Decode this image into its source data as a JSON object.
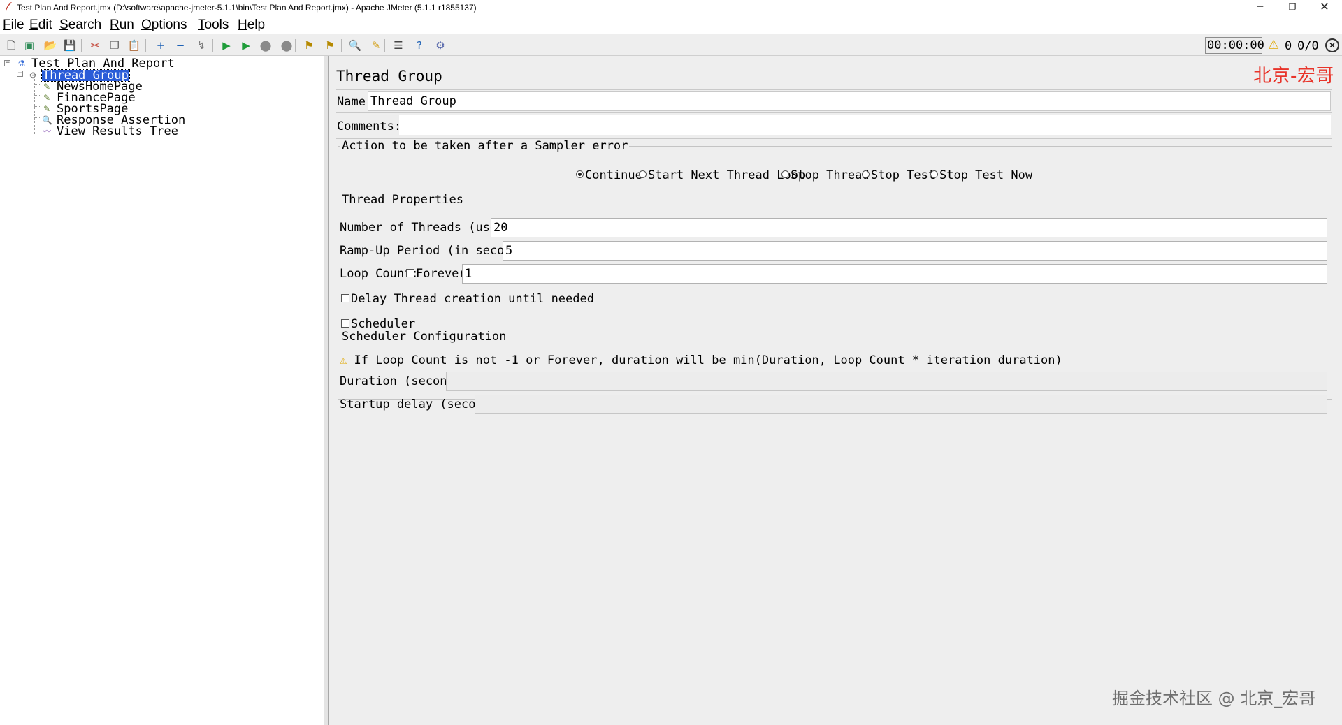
{
  "window": {
    "title": "Test Plan And Report.jmx (D:\\software\\apache-jmeter-5.1.1\\bin\\Test Plan And Report.jmx) - Apache JMeter (5.1.1 r1855137)",
    "minimize_glyph": "─",
    "maximize_glyph": "❐",
    "close_glyph": "✕"
  },
  "menu": {
    "items": [
      "File",
      "Edit",
      "Search",
      "Run",
      "Options",
      "Tools",
      "Help"
    ]
  },
  "toolbar": {
    "buttons": [
      {
        "name": "new-icon",
        "glyph": "🗋",
        "color": "#555555"
      },
      {
        "name": "templates-icon",
        "glyph": "▣",
        "color": "#2e8b57"
      },
      {
        "name": "open-icon",
        "glyph": "📂",
        "color": "#c8a032"
      },
      {
        "name": "save-icon",
        "glyph": "💾",
        "color": "#333333"
      },
      {
        "name": "cut-icon",
        "glyph": "✂",
        "color": "#c0392b"
      },
      {
        "name": "copy-icon",
        "glyph": "❐",
        "color": "#666666"
      },
      {
        "name": "paste-icon",
        "glyph": "📋",
        "color": "#8a6d3b"
      },
      {
        "name": "expand-icon",
        "glyph": "+",
        "color": "#1a5fb4"
      },
      {
        "name": "collapse-icon",
        "glyph": "−",
        "color": "#1a5fb4"
      },
      {
        "name": "toggle-icon",
        "glyph": "↯",
        "color": "#777777"
      },
      {
        "name": "start-icon",
        "glyph": "▶",
        "color": "#1f9d3a"
      },
      {
        "name": "start-no-pauses-icon",
        "glyph": "▶",
        "color": "#1f9d3a"
      },
      {
        "name": "stop-icon",
        "glyph": "⬤",
        "color": "#8a8a8a"
      },
      {
        "name": "shutdown-icon",
        "glyph": "⬤",
        "color": "#8a8a8a"
      },
      {
        "name": "clear-icon",
        "glyph": "⚑",
        "color": "#b58900"
      },
      {
        "name": "clear-all-icon",
        "glyph": "⚑",
        "color": "#b58900"
      },
      {
        "name": "search-icon",
        "glyph": "🔍",
        "color": "#333333"
      },
      {
        "name": "reset-search-icon",
        "glyph": "✎",
        "color": "#d4a017"
      },
      {
        "name": "function-helper-icon",
        "glyph": "☰",
        "color": "#444444"
      },
      {
        "name": "help-icon",
        "glyph": "?",
        "color": "#1a5fb4"
      },
      {
        "name": "remote-icon",
        "glyph": "⚙",
        "color": "#5566aa"
      }
    ],
    "elapsed_time": "00:00:00",
    "warning_glyph": "⚠",
    "error_count": "0",
    "thread_count": "0/0",
    "status_glyph": "✕"
  },
  "tree": {
    "nodes": [
      {
        "label": "Test Plan And Report",
        "icon": "test-plan-icon",
        "glyph": "⚗"
      },
      {
        "label": "Thread Group",
        "icon": "thread-group-icon",
        "glyph": "⚙",
        "selected": true
      },
      {
        "label": "NewsHomePage",
        "icon": "http-sampler-icon",
        "glyph": "✎"
      },
      {
        "label": "FinancePage",
        "icon": "http-sampler-icon",
        "glyph": "✎"
      },
      {
        "label": "SportsPage",
        "icon": "http-sampler-icon",
        "glyph": "✎"
      },
      {
        "label": "Response Assertion",
        "icon": "assertion-icon",
        "glyph": "🔍"
      },
      {
        "label": "View Results Tree",
        "icon": "listener-icon",
        "glyph": "〰"
      }
    ]
  },
  "panel": {
    "title": "Thread Group",
    "watermark_top": "北京-宏哥",
    "watermark_bottom": "掘金技术社区 @ 北京_宏哥",
    "name_label": "Name:",
    "name_value": "Thread Group",
    "comments_label": "Comments:",
    "comments_value": "",
    "sampler_error": {
      "legend": "Action to be taken after a Sampler error",
      "options": [
        "Continue",
        "Start Next Thread Loop",
        "Stop Thread",
        "Stop Test",
        "Stop Test Now"
      ],
      "selected": "Continue"
    },
    "thread_properties": {
      "legend": "Thread Properties",
      "threads_label": "Number of Threads (users):",
      "threads_value": "20",
      "rampup_label": "Ramp-Up Period (in seconds):",
      "rampup_value": "5",
      "loop_label": "Loop Count:",
      "forever_label": "Forever",
      "forever_checked": false,
      "loop_value": "1",
      "delay_label": "Delay Thread creation until needed",
      "delay_checked": false,
      "scheduler_label": "Scheduler",
      "scheduler_checked": false
    },
    "scheduler_config": {
      "legend": "Scheduler Configuration",
      "warning_glyph": "⚠",
      "warning_text": "If Loop Count is not -1 or Forever, duration will be min(Duration, Loop Count * iteration duration)",
      "duration_label": "Duration (seconds)",
      "duration_value": "",
      "startup_label": "Startup delay (seconds)",
      "startup_value": ""
    }
  },
  "colors": {
    "selection": "#2a5cd8",
    "watermark_red": "#e8342a",
    "panel_bg": "#eeeeee",
    "warning_yellow": "#e0a800"
  }
}
